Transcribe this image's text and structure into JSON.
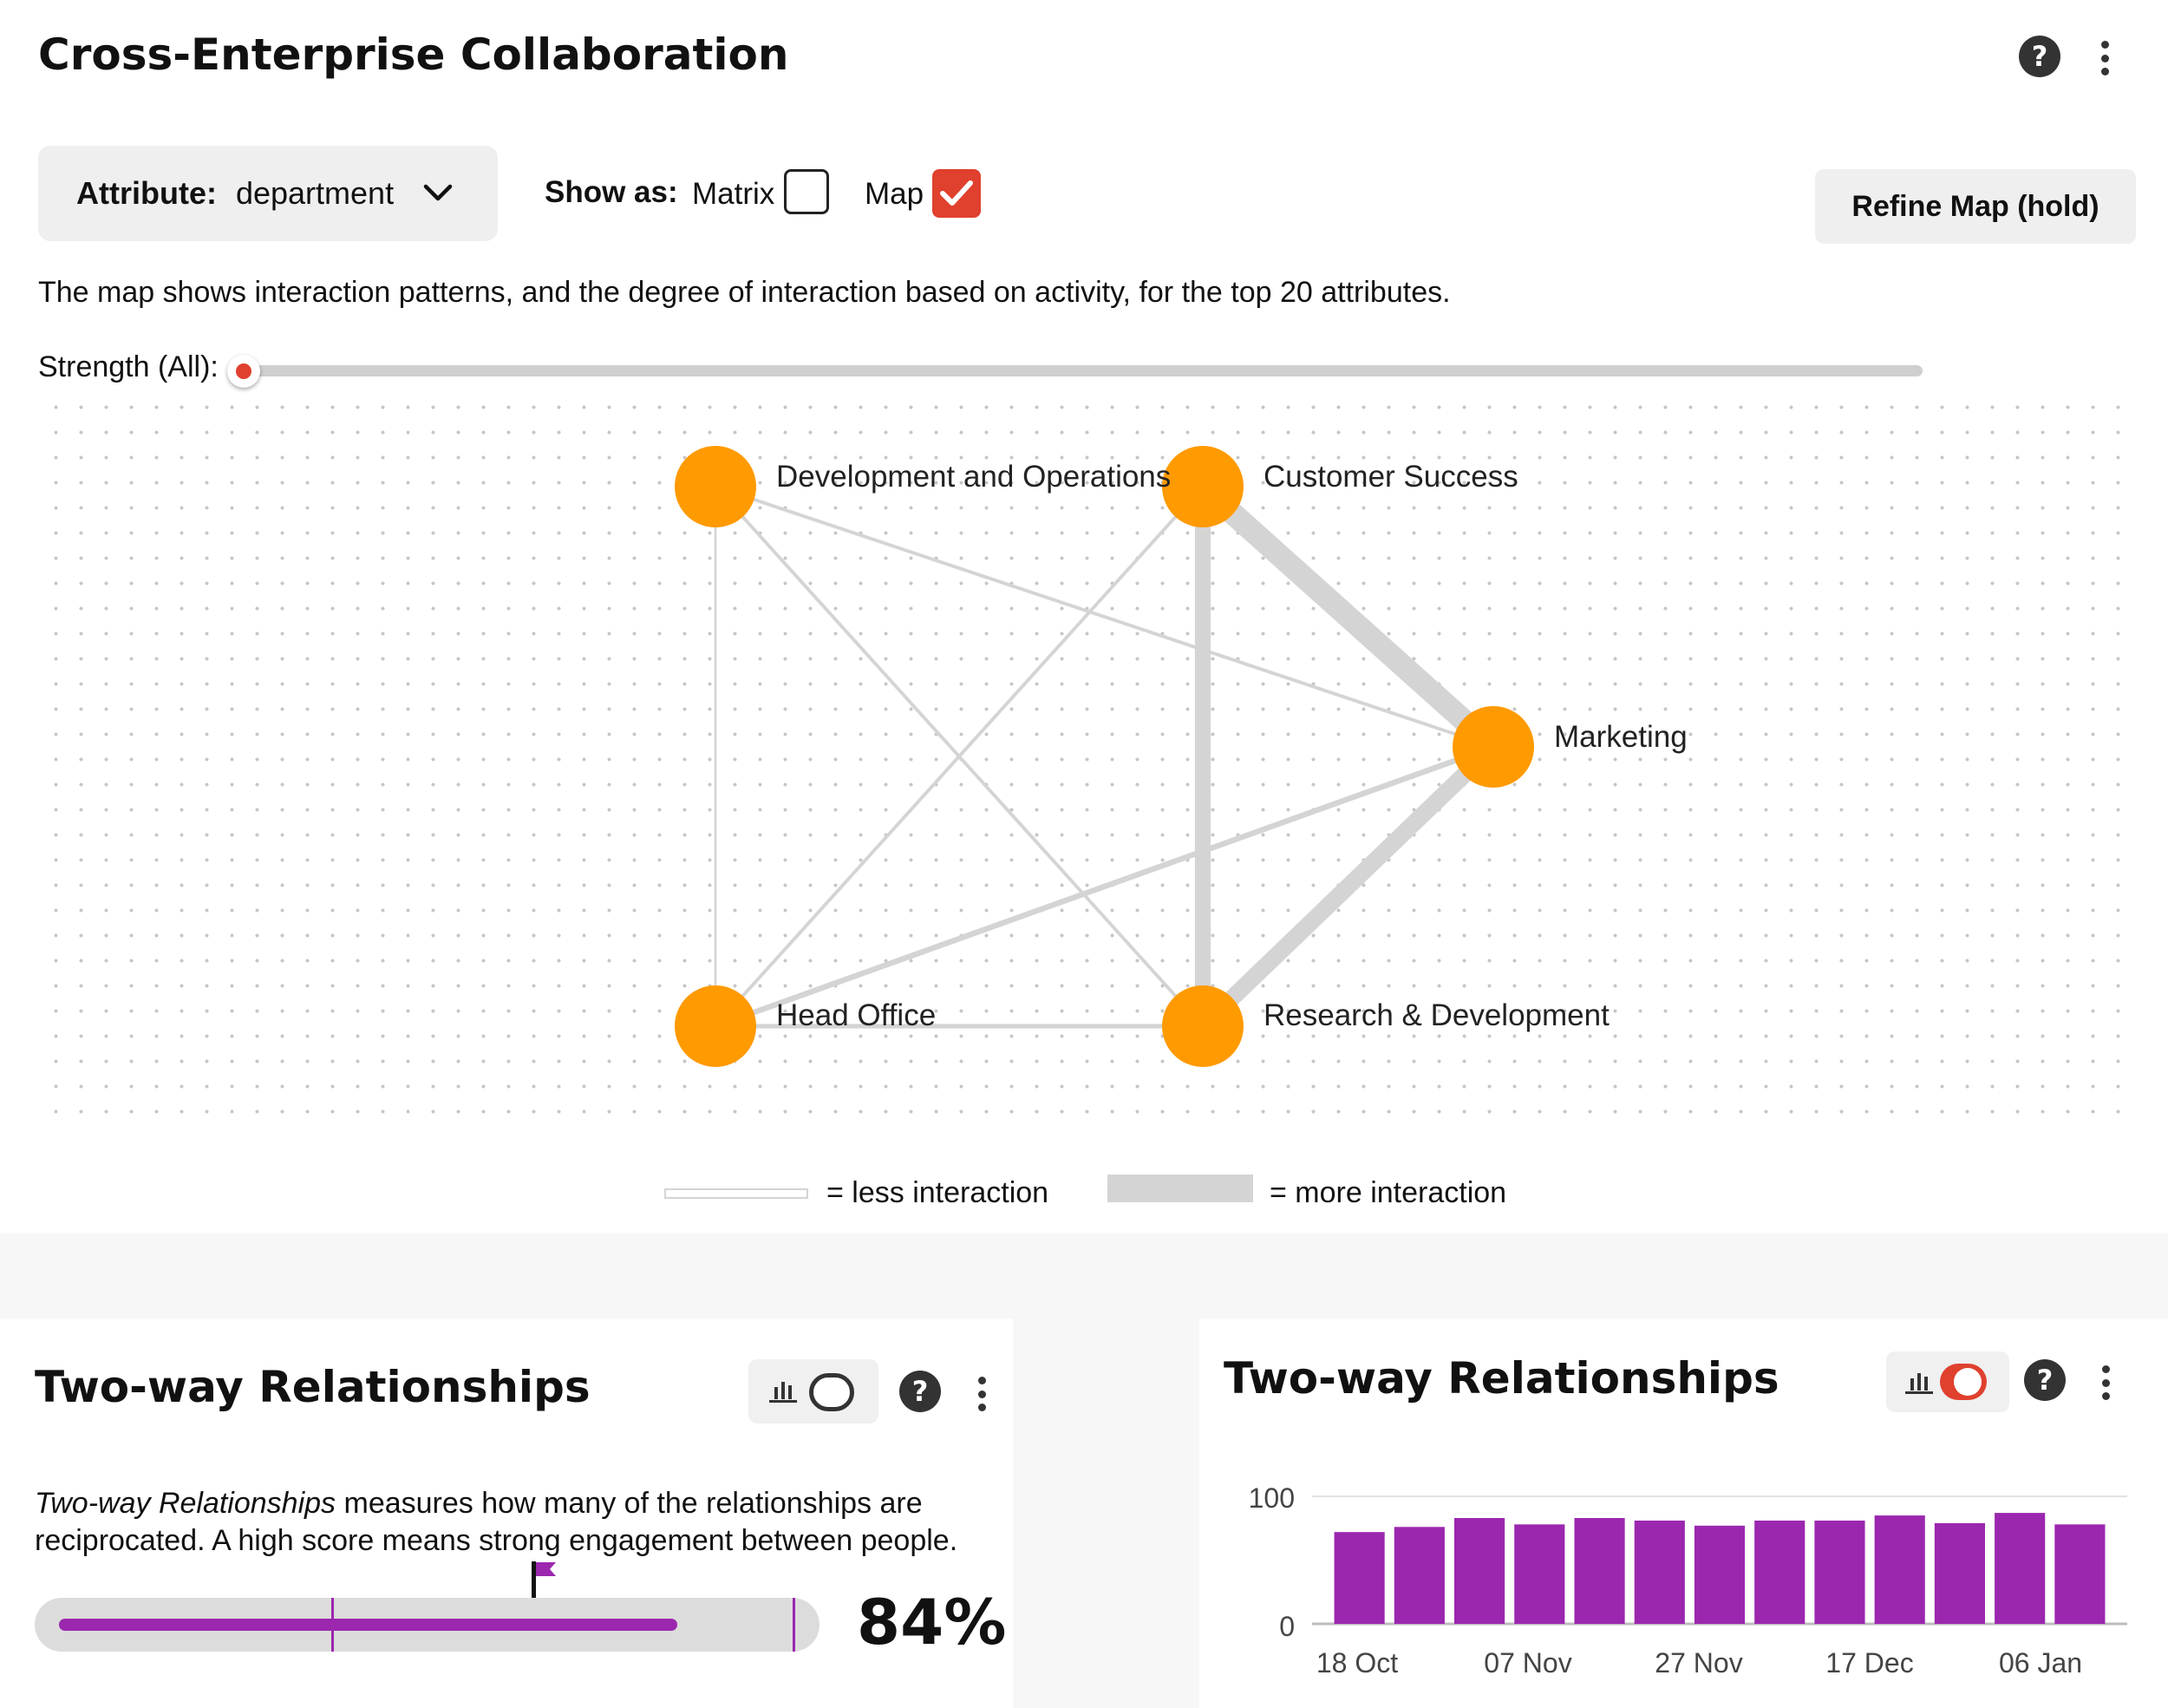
{
  "collab": {
    "title": "Cross-Enterprise Collaboration",
    "attribute_label": "Attribute:",
    "attribute_value": "department",
    "show_as_label": "Show as:",
    "matrix_label": "Matrix",
    "map_label": "Map",
    "matrix_checked": false,
    "map_checked": true,
    "refine_button": "Refine Map (hold)",
    "description": "The map shows interaction patterns, and the degree of interaction based on activity, for the top 20 attributes.",
    "strength_label": "Strength (All):",
    "strength_value": 0,
    "legend_less": "= less interaction",
    "legend_more": "= more interaction",
    "node_color": "#ff9a00",
    "edge_color": "#d4d4d4",
    "accent": "#e0402e",
    "nodes": [
      {
        "id": "devops",
        "label": "Development and Operations"
      },
      {
        "id": "cs",
        "label": "Customer Success"
      },
      {
        "id": "mkt",
        "label": "Marketing"
      },
      {
        "id": "ho",
        "label": "Head Office"
      },
      {
        "id": "rd",
        "label": "Research & Development"
      }
    ],
    "edges": [
      {
        "from": "devops",
        "to": "ho",
        "strength": 1
      },
      {
        "from": "devops",
        "to": "mkt",
        "strength": 1.5
      },
      {
        "from": "devops",
        "to": "rd",
        "strength": 1.5
      },
      {
        "from": "cs",
        "to": "ho",
        "strength": 1.5
      },
      {
        "from": "cs",
        "to": "mkt",
        "strength": 10
      },
      {
        "from": "cs",
        "to": "rd",
        "strength": 7
      },
      {
        "from": "mkt",
        "to": "ho",
        "strength": 2.5
      },
      {
        "from": "mkt",
        "to": "rd",
        "strength": 7.5
      },
      {
        "from": "ho",
        "to": "rd",
        "strength": 2
      }
    ]
  },
  "twoway_left": {
    "title": "Two-way Relationships",
    "description_italic": "Two-way Relationships",
    "description_rest": " measures how many of the relationships are reciprocated. A high score means strong engagement between people.",
    "percent": "84%",
    "progress": 0.84,
    "benchmark": 0.64,
    "marker": 0.37,
    "fill_color": "#9b27af"
  },
  "twoway_right": {
    "title": "Two-way Relationships",
    "chart_data": {
      "type": "bar",
      "categories": [
        "",
        "18 Oct",
        "",
        "",
        "07 Nov",
        "",
        "",
        "27 Nov",
        "",
        "",
        "17 Dec",
        "",
        "",
        "06 Jan"
      ],
      "values": [
        72,
        76,
        83,
        78,
        83,
        81,
        77,
        81,
        81,
        85,
        79,
        87,
        78
      ],
      "ylim": [
        0,
        100
      ],
      "yticks": [
        "100",
        "0"
      ],
      "xtick_labels": [
        "18 Oct",
        "07 Nov",
        "27 Nov",
        "17 Dec",
        "06 Jan"
      ],
      "bar_color": "#9b27af",
      "grid": true
    }
  }
}
